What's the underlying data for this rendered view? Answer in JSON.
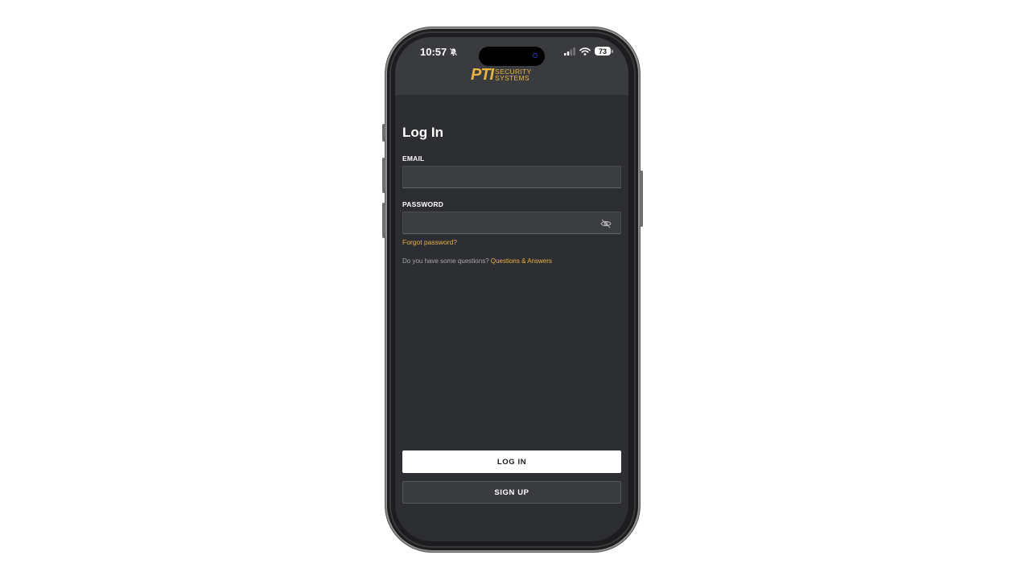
{
  "status_bar": {
    "time": "10:57",
    "battery": "73",
    "icons": [
      "bell-slash-icon",
      "cellular-signal-icon",
      "wifi-icon",
      "battery-icon"
    ]
  },
  "logo": {
    "main": "PTI",
    "line1": "SECURITY",
    "line2": "SYSTEMS",
    "color": "#e8b341"
  },
  "login": {
    "title": "Log In",
    "email_label": "EMAIL",
    "email_value": "",
    "password_label": "PASSWORD",
    "password_value": "",
    "forgot_password": "Forgot password?",
    "questions_text": "Do you have some questions?",
    "questions_link": "Questions & Answers",
    "login_button": "LOG IN",
    "signup_button": "SIGN UP"
  },
  "colors": {
    "background": "#2d2e32",
    "header": "#3a3b3f",
    "accent": "#e8b341"
  }
}
